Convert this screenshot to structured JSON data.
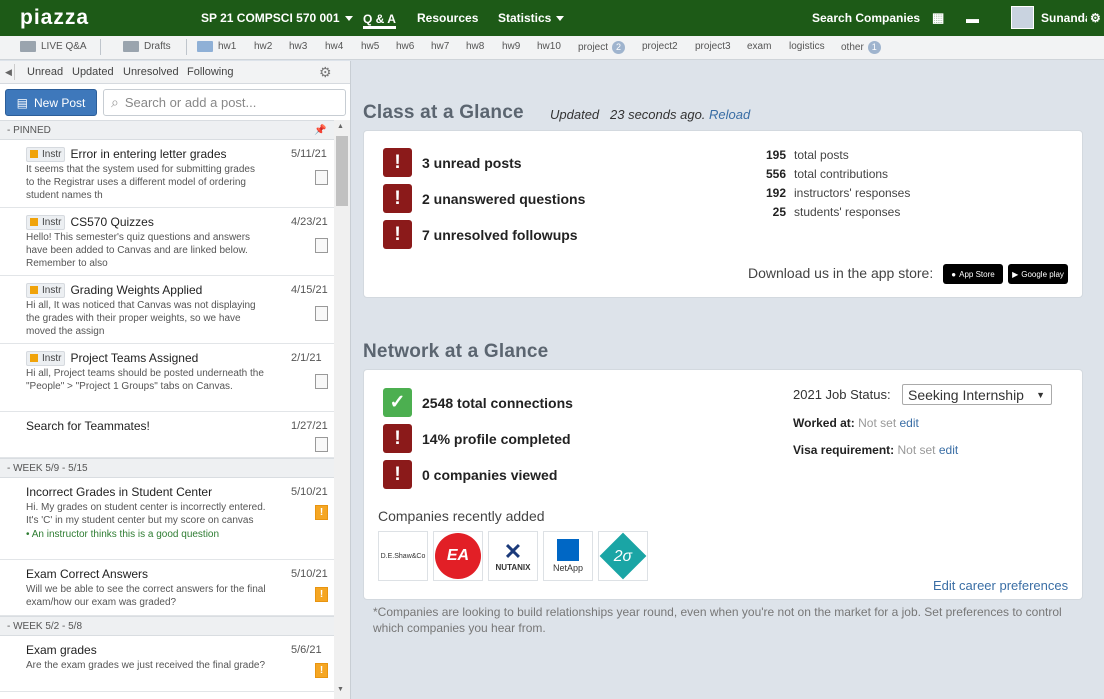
{
  "app": {
    "logo": "piazza",
    "course": "SP 21 COMPSCI 570 001",
    "user": "Sunanda"
  },
  "topnav": {
    "qa": "Q & A",
    "resources": "Resources",
    "statistics": "Statistics",
    "search_companies": "Search Companies"
  },
  "folders": {
    "live": "LIVE Q&A",
    "drafts": "Drafts",
    "items": [
      "hw1",
      "hw2",
      "hw3",
      "hw4",
      "hw5",
      "hw6",
      "hw7",
      "hw8",
      "hw9",
      "hw10"
    ],
    "project": "project",
    "project_badge": "2",
    "project2": "project2",
    "project3": "project3",
    "exam": "exam",
    "logistics": "logistics",
    "other": "other",
    "other_badge": "1"
  },
  "filters": [
    "Unread",
    "Updated",
    "Unresolved",
    "Following"
  ],
  "newpost": "New Post",
  "search": {
    "placeholder": "Search or add a post..."
  },
  "groups": {
    "pinned": "PINNED",
    "week1": "WEEK 5/9 - 5/15",
    "week2": "WEEK 5/2 - 5/8"
  },
  "tag": "Instr",
  "posts": [
    {
      "title": "Error in entering letter grades",
      "date": "5/11/21",
      "snippet": "It seems that the system used for submitting grades to the Registrar uses a different model of ordering student names th"
    },
    {
      "title": "CS570 Quizzes",
      "date": "4/23/21",
      "snippet": "Hello! This semester's quiz questions and answers have been added to Canvas and are linked below. Remember to also"
    },
    {
      "title": "Grading Weights Applied",
      "date": "4/15/21",
      "snippet": "Hi all, It was noticed that Canvas was not displaying the grades with their proper weights, so we have moved the assign"
    },
    {
      "title": "Project Teams Assigned",
      "date": "2/1/21",
      "snippet": "Hi all, Project teams should be posted underneath the \"People\" > \"Project 1 Groups\" tabs on Canvas."
    },
    {
      "title": "Search for Teammates!",
      "date": "1/27/21",
      "snippet": ""
    },
    {
      "title": "Incorrect Grades in Student Center",
      "date": "5/10/21",
      "snippet": "Hi. My grades on student center is incorrectly entered. It's 'C' in my student center but my score on canvas",
      "note": "An instructor thinks this is a good question"
    },
    {
      "title": "Exam Correct Answers",
      "date": "5/10/21",
      "snippet": "Will we be able to see the correct answers for the final exam/how our exam was graded?"
    },
    {
      "title": "Exam grades",
      "date": "5/6/21",
      "snippet": "Are the exam grades we just received the final grade?"
    }
  ],
  "class_glance": {
    "title": "Class at a Glance",
    "updated": "Updated",
    "ago": "23 seconds ago.",
    "reload": "Reload",
    "alerts": [
      "3 unread posts",
      "2 unanswered questions",
      "7 unresolved followups"
    ],
    "stats": [
      {
        "n": "195",
        "label": "total posts"
      },
      {
        "n": "556",
        "label": "total contributions"
      },
      {
        "n": "192",
        "label": "instructors' responses"
      },
      {
        "n": "25",
        "label": "students' responses"
      }
    ],
    "download": "Download us in the app store:",
    "appstore": "App Store",
    "googleplay": "Google play"
  },
  "network_glance": {
    "title": "Network at a Glance",
    "alerts": [
      "2548 total connections",
      "14% profile completed",
      "0 companies viewed"
    ],
    "job_status_label": "2021 Job Status:",
    "job_status": "Seeking Internship",
    "worked_at_label": "Worked at:",
    "worked_at": "Not set",
    "edit": "edit",
    "visa_label": "Visa requirement:",
    "visa": "Not set",
    "companies_label": "Companies recently added",
    "companies": [
      "D.E.Shaw&Co",
      "EA",
      "NUTANIX",
      "NetApp",
      "2σ"
    ],
    "edit_prefs": "Edit career preferences",
    "footnote": "*Companies are looking to build relationships year round, even when you're not on the market for a job. Set preferences to control which companies you hear from."
  },
  "colors": {
    "topbar": "#1d5a17",
    "alert": "#8b1a1a",
    "ok": "#4caf50",
    "link": "#3a6ea5",
    "accent": "#3e78bb"
  }
}
